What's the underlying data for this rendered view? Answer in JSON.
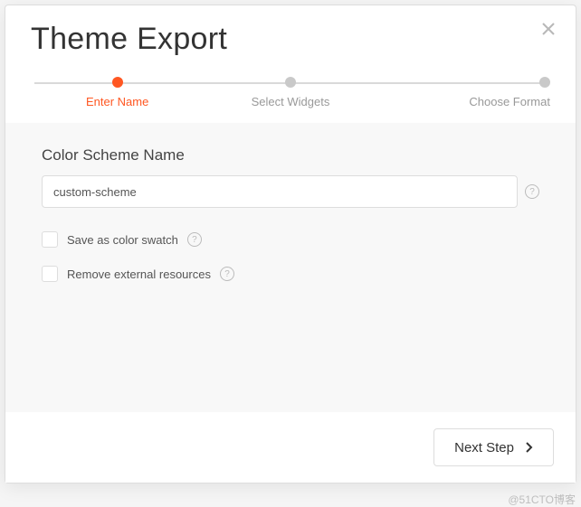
{
  "modal": {
    "title": "Theme Export"
  },
  "stepper": {
    "steps": [
      {
        "label": "Enter Name"
      },
      {
        "label": "Select Widgets"
      },
      {
        "label": "Choose Format"
      }
    ]
  },
  "form": {
    "scheme_label": "Color Scheme Name",
    "scheme_value": "custom-scheme",
    "option_swatch": "Save as color swatch",
    "option_remove": "Remove external resources"
  },
  "footer": {
    "next_label": "Next Step"
  },
  "watermark": "@51CTO博客"
}
